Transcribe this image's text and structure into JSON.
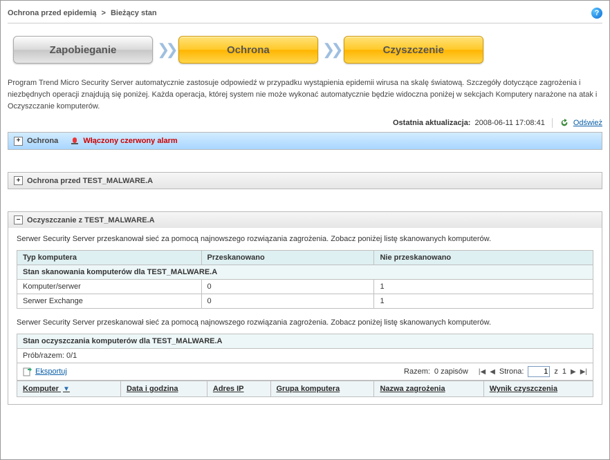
{
  "breadcrumb": {
    "group": "Ochrona przed epidemią",
    "sep": ">",
    "page": "Bieżący stan"
  },
  "steps": {
    "prevent": "Zapobieganie",
    "protect": "Ochrona",
    "clean": "Czyszczenie",
    "arrow": "❯❯"
  },
  "intro": "Program Trend Micro Security Server automatycznie zastosuje odpowiedź w przypadku wystąpienia epidemii wirusa na skalę światową. Szczegóły dotyczące zagrożenia i niezbędnych operacji znajdują się poniżej. Każda operacja, której system nie może wykonać automatycznie będzie widoczna poniżej w sekcjach Komputery narażone na atak i Oczyszczanie komputerów.",
  "update": {
    "label": "Ostatnia aktualizacja:",
    "value": "2008-06-11 17:08:41",
    "refresh": "Odśwież"
  },
  "panel1": {
    "toggle": "+",
    "title": "Ochrona",
    "alarm": "Włączony czerwony alarm"
  },
  "panel2": {
    "toggle": "+",
    "title": "Ochrona przed TEST_MALWARE.A"
  },
  "panel3": {
    "toggle": "−",
    "title": "Oczyszczanie z TEST_MALWARE.A",
    "desc1": "Serwer Security Server przeskanował sieć za pomocą najnowszego rozwiązania zagrożenia. Zobacz poniżej listę skanowanych komputerów.",
    "scanTable": {
      "caption": "Stan skanowania komputerów dla TEST_MALWARE.A",
      "h_type": "Typ komputera",
      "h_scanned": "Przeskanowano",
      "h_not": "Nie przeskanowano",
      "rows": [
        {
          "type": "Komputer/serwer",
          "scanned": "0",
          "not": "1"
        },
        {
          "type": "Serwer Exchange",
          "scanned": "0",
          "not": "1"
        }
      ]
    },
    "desc2": "Serwer Security Server przeskanował sieć za pomocą najnowszego rozwiązania zagrożenia. Zobacz poniżej listę skanowanych komputerów.",
    "cleanTable": {
      "caption": "Stan oczyszczania komputerów dla TEST_MALWARE.A",
      "attempts_label": "Prób/razem:",
      "attempts_value": "0/1",
      "export": "Eksportuj",
      "total_label": "Razem:",
      "total_value": "0 zapisów",
      "page_label": "Strona:",
      "page_value": "1",
      "page_of": "z",
      "page_total": "1",
      "cols": {
        "computer": "Komputer",
        "datetime": "Data i godzina",
        "ip": "Adres IP",
        "group": "Grupa komputera",
        "threat": "Nazwa zagrożenia",
        "result": "Wynik czyszczenia"
      }
    }
  }
}
